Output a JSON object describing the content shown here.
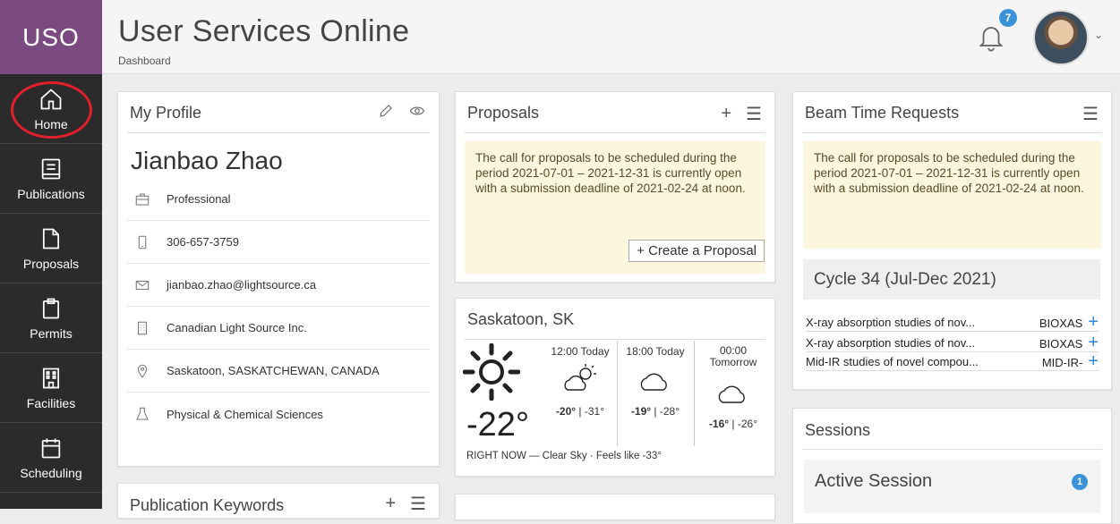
{
  "app": {
    "logo": "USO",
    "title": "User Services Online",
    "breadcrumb": "Dashboard",
    "notification_count": "7"
  },
  "sidebar": {
    "items": [
      {
        "label": "Home",
        "icon": "home-icon"
      },
      {
        "label": "Publications",
        "icon": "publications-icon"
      },
      {
        "label": "Proposals",
        "icon": "proposals-icon"
      },
      {
        "label": "Permits",
        "icon": "permits-icon"
      },
      {
        "label": "Facilities",
        "icon": "facilities-icon"
      },
      {
        "label": "Scheduling",
        "icon": "scheduling-icon"
      }
    ]
  },
  "profile": {
    "title": "My Profile",
    "name": "Jianbao Zhao",
    "rows": [
      {
        "icon": "briefcase-icon",
        "text": "Professional"
      },
      {
        "icon": "phone-icon",
        "text": "306-657-3759"
      },
      {
        "icon": "email-icon",
        "text": "jianbao.zhao@lightsource.ca"
      },
      {
        "icon": "building-icon",
        "text": "Canadian Light Source Inc."
      },
      {
        "icon": "location-icon",
        "text": "Saskatoon, SASKATCHEWAN, CANADA"
      },
      {
        "icon": "flask-icon",
        "text": "Physical & Chemical Sciences"
      }
    ]
  },
  "publication_keywords": {
    "title": "Publication Keywords"
  },
  "proposals": {
    "title": "Proposals",
    "notice": "The call for proposals to be scheduled during the period 2021-07-01 – 2021-12-31 is currently open with a submission deadline of 2021-02-24 at noon.",
    "create_label": "Create a Proposal"
  },
  "weather": {
    "title": "Saskatoon, SK",
    "current_temp": "-22°",
    "forecast": [
      {
        "time": "12:00 Today",
        "high": "-20°",
        "low": "-31°"
      },
      {
        "time": "18:00 Today",
        "high": "-19°",
        "low": "-28°"
      },
      {
        "time": "00:00 Tomorrow",
        "high": "-16°",
        "low": "-26°"
      }
    ],
    "now_label": "RIGHT NOW",
    "now_text": "Clear Sky · Feels like -33°"
  },
  "beam_time": {
    "title": "Beam Time Requests",
    "notice": "The call for proposals to be scheduled during the period 2021-07-01 – 2021-12-31 is currently open with a submission deadline of 2021-02-24 at noon.",
    "cycle": "Cycle 34 (Jul-Dec 2021)",
    "requests": [
      {
        "title": "X-ray absorption studies of nov...",
        "beamline": "BIOXAS"
      },
      {
        "title": "X-ray absorption studies of nov...",
        "beamline": "BIOXAS"
      },
      {
        "title": "Mid-IR studies of novel compou...",
        "beamline": "MID-IR-"
      }
    ]
  },
  "sessions": {
    "title": "Sessions",
    "active_label": "Active Session",
    "active_count": "1"
  },
  "colors": {
    "sidebar_bg": "#2b2b2b",
    "logo_bg": "#7b4a80",
    "accent": "#3a93d6",
    "notice_bg": "#fcf6df",
    "highlight_ring": "#e0202a"
  }
}
